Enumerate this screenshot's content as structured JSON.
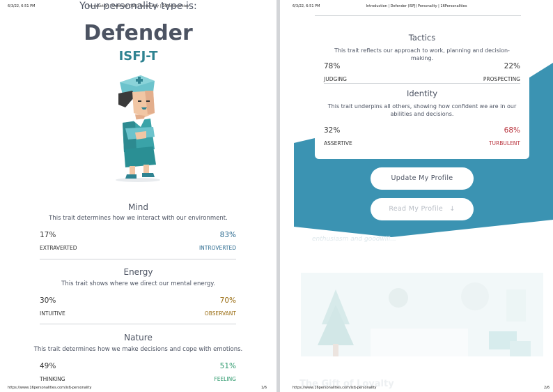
{
  "print_header": {
    "left_timestamp": "6/3/22, 6:51 PM",
    "title": "Introduction | Defender (ISFJ) Personality | 16Personalities"
  },
  "print_footer": {
    "url": "https://www.16personalities.com/isfj-personality",
    "page1": "1/6",
    "page2": "2/6"
  },
  "page1": {
    "intro": "Your personality type is:",
    "type_name": "Defender",
    "type_code": "ISFJ-T",
    "traits": [
      {
        "title": "Mind",
        "desc": "This trait determines how we interact with our environment.",
        "left_pct": "17%",
        "right_pct": "83%",
        "left_label": "EXTRAVERTED",
        "right_label": "INTROVERTED",
        "dominant_color": "#2b6a8f"
      },
      {
        "title": "Energy",
        "desc": "This trait shows where we direct our mental energy.",
        "left_pct": "30%",
        "right_pct": "70%",
        "left_label": "INTUITIVE",
        "right_label": "OBSERVANT",
        "dominant_color": "#9a6d12"
      },
      {
        "title": "Nature",
        "desc": "This trait determines how we make decisions and cope with emotions.",
        "left_pct": "49%",
        "right_pct": "51%",
        "left_label": "THINKING",
        "right_label": "FEELING",
        "dominant_color": "#2f9a6e"
      }
    ]
  },
  "page2": {
    "traits": [
      {
        "title": "Tactics",
        "desc": "This trait reflects our approach to work, planning and decision-making.",
        "left_pct": "78%",
        "right_pct": "22%",
        "left_label": "JUDGING",
        "right_label": "PROSPECTING",
        "dominant_color": "#5b4a8a"
      },
      {
        "title": "Identity",
        "desc": "This trait underpins all others, showing how confident we are in our abilities and decisions.",
        "left_pct": "32%",
        "right_pct": "68%",
        "left_label": "ASSERTIVE",
        "right_label": "TURBULENT",
        "dominant_color": "#b8323c"
      }
    ],
    "update_button": "Update My Profile",
    "read_button": "Read My Profile",
    "faded_text": "enthusiasm and goodwill...",
    "faded_heading": "The Gift of Loyalty"
  },
  "colors": {
    "teal": "#3b93b2",
    "heading": "#4c5362",
    "code": "#2f8391"
  }
}
